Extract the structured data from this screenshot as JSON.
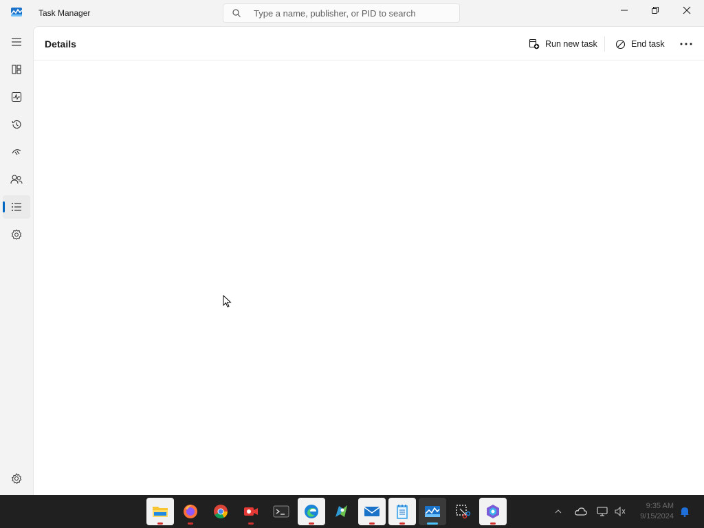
{
  "window": {
    "title": "Task Manager",
    "search_placeholder": "Type a name, publisher, or PID to search"
  },
  "nav": {
    "items": [
      {
        "name": "hamburger-menu",
        "icon": "menu-icon"
      },
      {
        "name": "processes",
        "icon": "processes-icon"
      },
      {
        "name": "performance",
        "icon": "performance-icon"
      },
      {
        "name": "app-history",
        "icon": "history-icon"
      },
      {
        "name": "startup-apps",
        "icon": "startup-icon"
      },
      {
        "name": "users",
        "icon": "users-icon"
      },
      {
        "name": "details",
        "icon": "details-icon",
        "active": true
      },
      {
        "name": "services",
        "icon": "services-icon"
      },
      {
        "name": "settings",
        "icon": "gear-icon"
      }
    ]
  },
  "page": {
    "title": "Details",
    "run_new_task": "Run new task",
    "end_task": "End task"
  },
  "taskbar": {
    "apps": [
      "File Explorer",
      "Firefox",
      "Chrome",
      "Screen Recorder",
      "Terminal",
      "Edge",
      "Maps",
      "Mail",
      "Notepad",
      "Task Manager",
      "Snipping Tool",
      "Copilot"
    ],
    "clock_time": "9:35 AM",
    "clock_date": "9/15/2024"
  },
  "colors": {
    "accent": "#0067c0",
    "taskbar": "#202020",
    "background": "#f3f3f3"
  }
}
